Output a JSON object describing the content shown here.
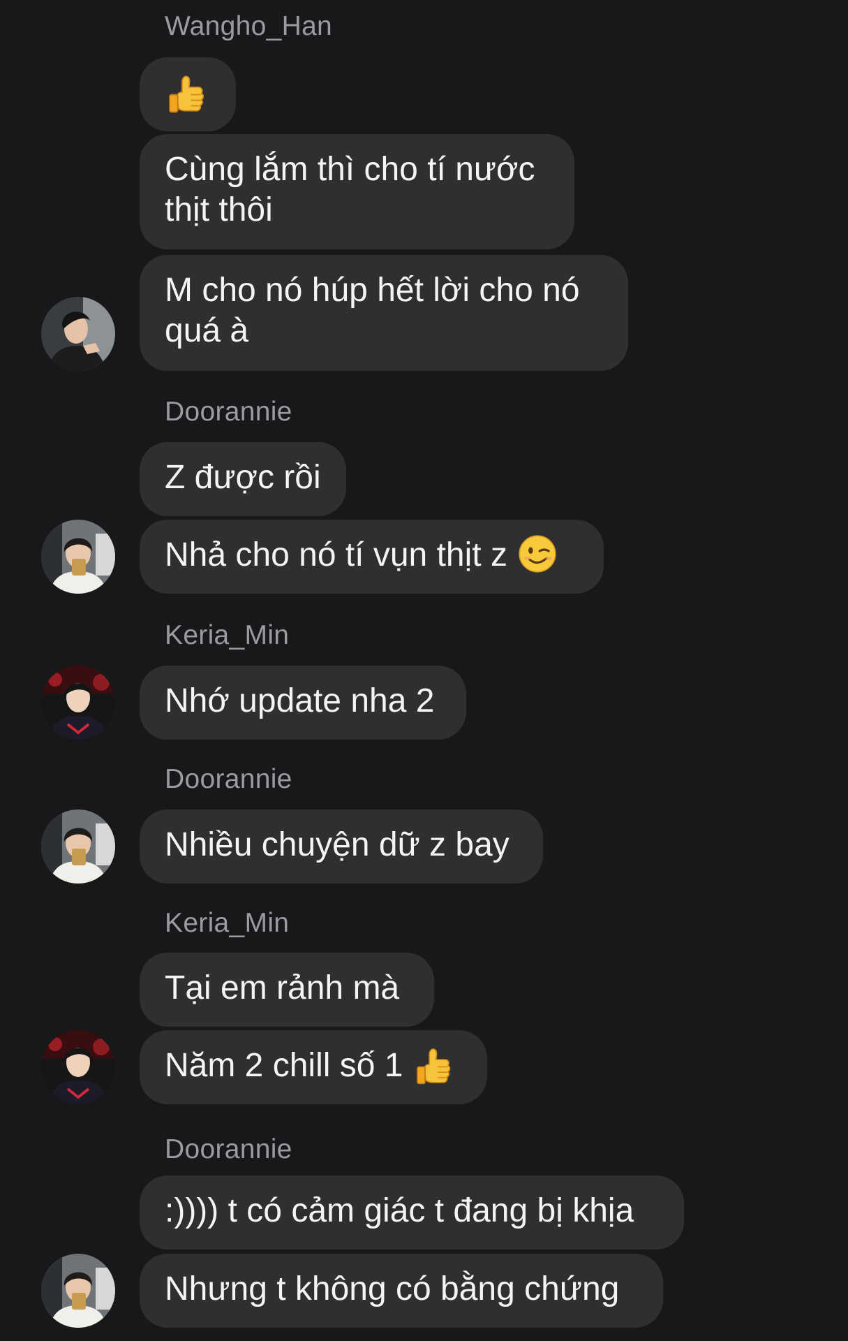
{
  "conversation": {
    "groups": [
      {
        "sender": "Wangho_Han",
        "messages": [
          {
            "text": "",
            "emoji": "thumbs-up"
          },
          {
            "text": "Cùng lắm thì cho tí nước thịt thôi"
          },
          {
            "text": "M cho nó húp hết lời cho nó quá à"
          }
        ]
      },
      {
        "sender": "Doorannie",
        "messages": [
          {
            "text": "Z được rồi"
          },
          {
            "text": "Nhả cho nó tí vụn thịt z",
            "emoji": "winking-face"
          }
        ]
      },
      {
        "sender": "Keria_Min",
        "messages": [
          {
            "text": "Nhớ update nha 2"
          }
        ]
      },
      {
        "sender": "Doorannie",
        "messages": [
          {
            "text": "Nhiều chuyện dữ z bay"
          }
        ]
      },
      {
        "sender": "Keria_Min",
        "messages": [
          {
            "text": "Tại em rảnh mà"
          },
          {
            "text": "Năm 2 chill số 1",
            "emoji": "thumbs-up"
          }
        ]
      },
      {
        "sender": "Doorannie",
        "messages": [
          {
            "text": ":)))) t có cảm giác t đang bị khịa"
          },
          {
            "text": "Nhưng t không có bằng chứng"
          }
        ]
      }
    ]
  },
  "colors": {
    "background": "#18181a",
    "bubble": "#2f2f31",
    "sender_name": "#9b9ba0",
    "message_text": "#f4f4f4"
  },
  "icons": {
    "avatar_wangho": "avatar-photo-wangho",
    "avatar_doorannie": "avatar-photo-doorannie",
    "avatar_keria": "avatar-photo-keria"
  }
}
